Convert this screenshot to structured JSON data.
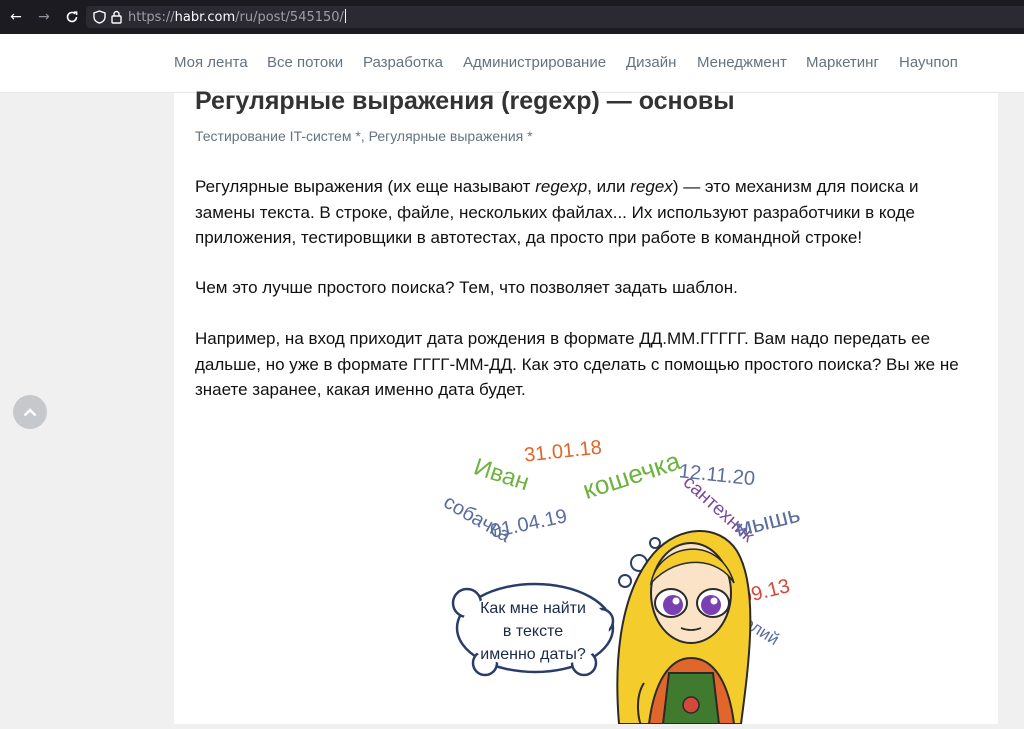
{
  "browser": {
    "back_icon": "arrow-left-icon",
    "forward_icon": "arrow-right-icon",
    "reload_icon": "reload-icon",
    "url_scheme": "https://",
    "url_host": "habr.com",
    "url_path": "/ru/post/545150/"
  },
  "nav": {
    "items": [
      "Моя лента",
      "Все потоки",
      "Разработка",
      "Администрирование",
      "Дизайн",
      "Менеджмент",
      "Маркетинг",
      "Научпоп"
    ]
  },
  "article": {
    "title": "Регулярные выражения (regexp) — основы",
    "hubs": [
      "Тестирование IT-систем *",
      "Регулярные выражения *"
    ],
    "p1_a": "Регулярные выражения (их еще называют ",
    "p1_em1": "regexp",
    "p1_b": ", или ",
    "p1_em2": "regex",
    "p1_c": ") — это механизм для поиска и замены текста. В строке, файле, нескольких файлах... Их используют разработчики в коде приложения, тестировщики в автотестах, да просто при работе в командной строке!",
    "p2": "Чем это лучше простого поиска? Тем, что позволяет задать шаблон.",
    "p3": "Например, на вход приходит дата рождения в формате ДД.ММ.ГГГГГ. Вам надо передать ее дальше, но уже в формате ГГГГ-ММ-ДД. Как это сделать с помощью простого поиска? Вы же не знаете заранее, какая именно дата будет."
  },
  "illustration": {
    "words": [
      "31.01.18",
      "Иван",
      "кошечка",
      "12.11.20",
      "сантехник",
      "мышь",
      "01.04.19",
      "собачка",
      "18.09.13",
      "Анатолий"
    ],
    "bubble": [
      "Как мне найти",
      "в тексте",
      "именно даты?"
    ]
  },
  "colors": {
    "orange": "#e0662b",
    "green": "#6db33f",
    "purple": "#7a4a9e",
    "blue": "#5a6e9e",
    "red": "#d44a3a"
  }
}
